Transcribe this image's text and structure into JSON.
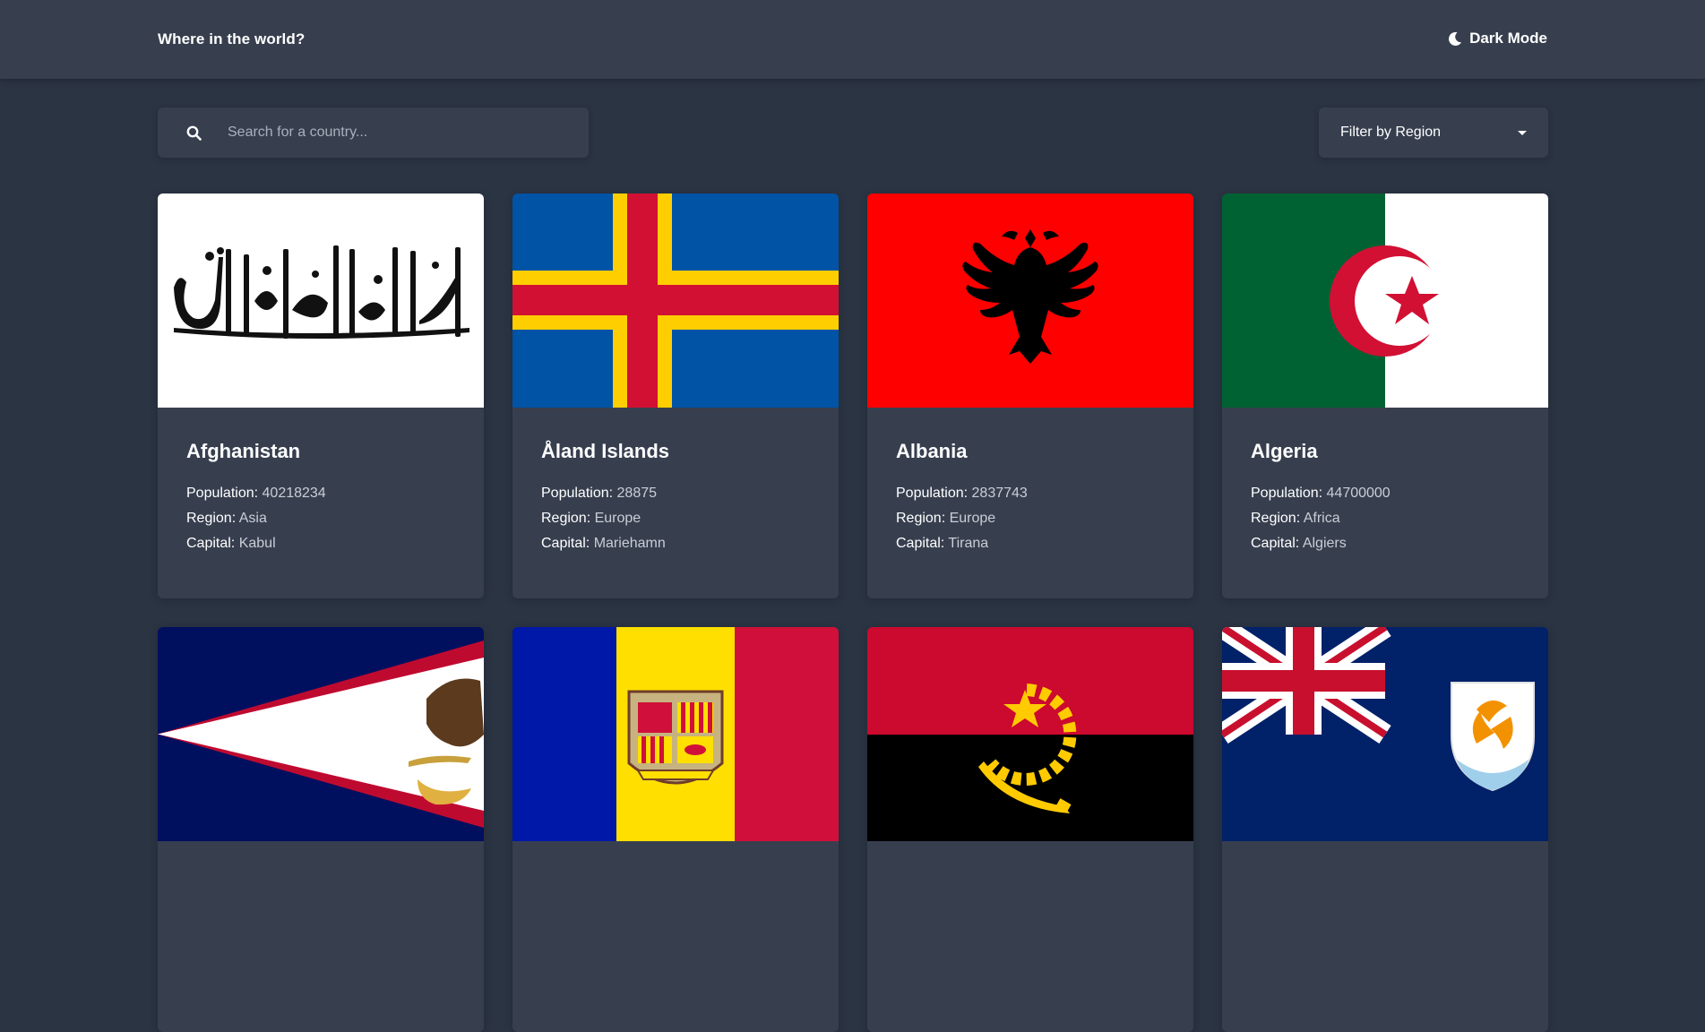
{
  "header": {
    "title": "Where in the world?",
    "mode_label": "Dark Mode",
    "mode_icon": "moon-icon"
  },
  "search": {
    "placeholder": "Search for a country...",
    "value": "",
    "icon": "search-icon"
  },
  "filter": {
    "label": "Filter by Region",
    "icon": "caret-down-icon"
  },
  "labels": {
    "population": "Population:",
    "region": "Region:",
    "capital": "Capital:"
  },
  "countries": [
    {
      "name": "Afghanistan",
      "population": "40218234",
      "region": "Asia",
      "capital": "Kabul"
    },
    {
      "name": "Åland Islands",
      "population": "28875",
      "region": "Europe",
      "capital": "Mariehamn"
    },
    {
      "name": "Albania",
      "population": "2837743",
      "region": "Europe",
      "capital": "Tirana"
    },
    {
      "name": "Algeria",
      "population": "44700000",
      "region": "Africa",
      "capital": "Algiers"
    },
    {
      "name": "",
      "population": "",
      "region": "",
      "capital": ""
    },
    {
      "name": "",
      "population": "",
      "region": "",
      "capital": ""
    },
    {
      "name": "",
      "population": "",
      "region": "",
      "capital": ""
    },
    {
      "name": "",
      "population": "",
      "region": "",
      "capital": ""
    }
  ],
  "colors": {
    "background": "#2b3443",
    "element": "#373f4f",
    "text": "#ffffff",
    "muted": "#c9ced6"
  }
}
